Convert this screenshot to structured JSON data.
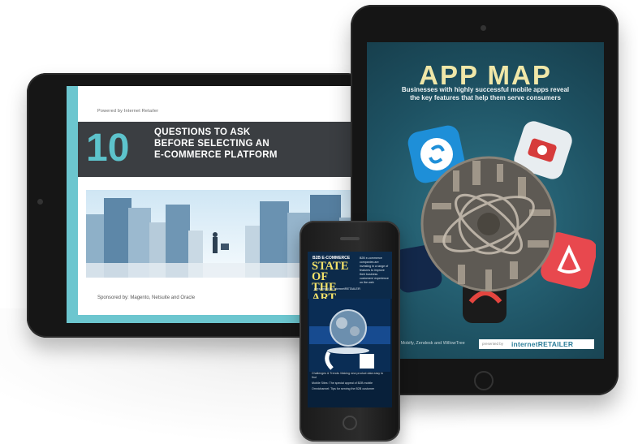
{
  "tablet_landscape": {
    "powered_by": "Powered by Internet Retailer",
    "number": "10",
    "headline_lines": [
      "QUESTIONS TO ASK",
      "BEFORE SELECTING AN",
      "E-COMMERCE PLATFORM"
    ],
    "sponsored_by": "Sponsored by: Magento, Netsuite and Oracle",
    "accent_color": "#6cc6cf",
    "band_color": "#3b3e42"
  },
  "tablet_portrait": {
    "title": "APP MAP",
    "subtitle_lines": [
      "Businesses with highly successful mobile apps reveal",
      "the key features that help them serve consumers"
    ],
    "credit": "ated by Mobify, Zendesk and WillowTree",
    "brand_prefix": "presented by",
    "brand": "internetRETAILER",
    "title_color": "#f0e7a8",
    "icons": [
      "shazam-icon",
      "red-camera-icon",
      "airbnb-icon",
      "city-globe-icon"
    ]
  },
  "phone": {
    "publication": "B2B E-COMMERCE",
    "title_lines": [
      "STATE OF",
      "THE ART"
    ],
    "presented_by": "presented by internetRETAILER",
    "blurb": "B2B e-commerce companies are investing in a range of features to improve their business customers' experience on the web",
    "list_items": [
      "Challenges & Trends: Making new product data easy to find",
      "Mobile Sites: The special appeal of B2B mobile",
      "Omnichannel: Tips for serving the B2B customer"
    ]
  }
}
